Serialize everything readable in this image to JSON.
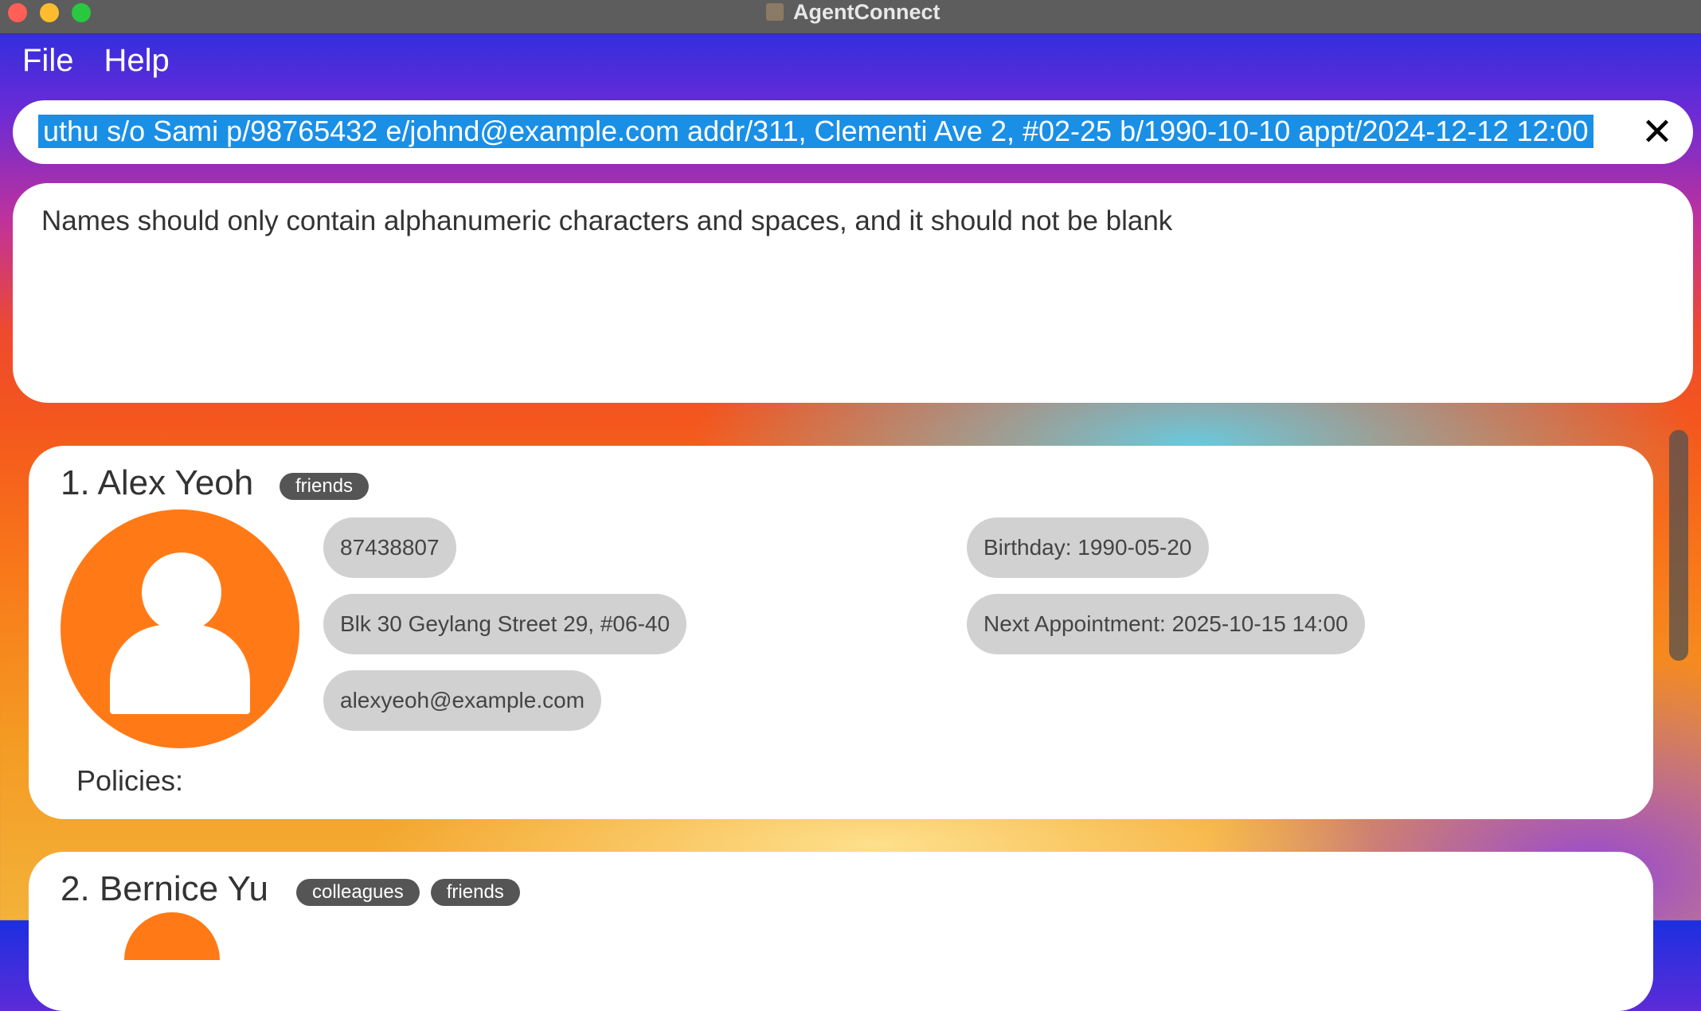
{
  "window": {
    "title": "AgentConnect"
  },
  "menu": {
    "file": "File",
    "help": "Help"
  },
  "command": {
    "value": "uthu s/o Sami p/98765432 e/johnd@example.com addr/311, Clementi Ave 2, #02-25 b/1990-10-10 appt/2024-12-12 12:00",
    "clear_icon": "✕"
  },
  "result": {
    "message": "Names should only contain alphanumeric characters and spaces, and it should not be blank"
  },
  "persons": [
    {
      "name": "1. Alex Yeoh",
      "tags": [
        "friends"
      ],
      "phone": "87438807",
      "address": "Blk 30 Geylang Street 29, #06-40",
      "email": "alexyeoh@example.com",
      "birthday": "Birthday: 1990-05-20",
      "appointment": "Next Appointment: 2025-10-15 14:00",
      "policies_label": "Policies:"
    },
    {
      "name": "2. Bernice Yu",
      "tags": [
        "colleagues",
        "friends"
      ]
    }
  ],
  "icons": {
    "avatar": "person-placeholder-icon",
    "clear": "close-icon"
  },
  "colors": {
    "avatar": "#ff7a16",
    "selection": "#1a8fe6",
    "tag": "#555555",
    "pill": "#d1d1d1"
  }
}
